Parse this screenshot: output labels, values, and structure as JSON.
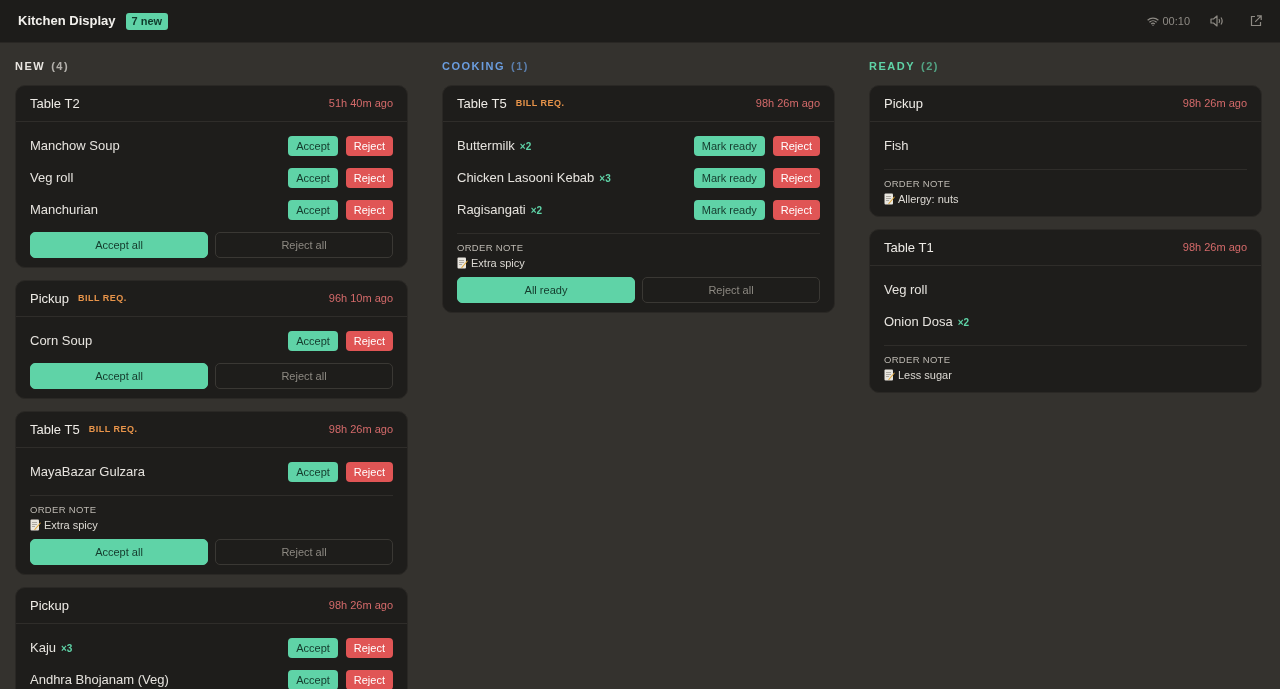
{
  "header": {
    "title": "Kitchen Display",
    "new_badge": "7 new",
    "connection_time": "00:10"
  },
  "columns": [
    {
      "title": "NEW",
      "count": "(4)",
      "color": "#e8e5e0",
      "orders": [
        {
          "name": "Table T2",
          "elapsed": "51h 40m ago",
          "items": [
            {
              "name": "Manchow Soup",
              "actions": [
                {
                  "label": "Accept",
                  "kind": "go"
                },
                {
                  "label": "Reject",
                  "kind": "stop"
                }
              ]
            },
            {
              "name": "Veg roll",
              "actions": [
                {
                  "label": "Accept",
                  "kind": "go"
                },
                {
                  "label": "Reject",
                  "kind": "stop"
                }
              ]
            },
            {
              "name": "Manchurian",
              "actions": [
                {
                  "label": "Accept",
                  "kind": "go"
                },
                {
                  "label": "Reject",
                  "kind": "stop"
                }
              ]
            }
          ],
          "footer": [
            {
              "label": "Accept all",
              "kind": "primary"
            },
            {
              "label": "Reject all",
              "kind": "outline"
            }
          ]
        },
        {
          "name": "Pickup",
          "badge": "BILL REQ.",
          "elapsed": "96h 10m ago",
          "items": [
            {
              "name": "Corn Soup",
              "actions": [
                {
                  "label": "Accept",
                  "kind": "go"
                },
                {
                  "label": "Reject",
                  "kind": "stop"
                }
              ]
            }
          ],
          "footer": [
            {
              "label": "Accept all",
              "kind": "primary"
            },
            {
              "label": "Reject all",
              "kind": "outline"
            }
          ]
        },
        {
          "name": "Table T5",
          "badge": "BILL REQ.",
          "elapsed": "98h 26m ago",
          "items": [
            {
              "name": "MayaBazar Gulzara",
              "actions": [
                {
                  "label": "Accept",
                  "kind": "go"
                },
                {
                  "label": "Reject",
                  "kind": "stop"
                }
              ]
            }
          ],
          "note_label": "ORDER NOTE",
          "note": "Extra spicy",
          "footer": [
            {
              "label": "Accept all",
              "kind": "primary"
            },
            {
              "label": "Reject all",
              "kind": "outline"
            }
          ]
        },
        {
          "name": "Pickup",
          "elapsed": "98h 26m ago",
          "items": [
            {
              "name": "Kaju",
              "qty": "×3",
              "actions": [
                {
                  "label": "Accept",
                  "kind": "go"
                },
                {
                  "label": "Reject",
                  "kind": "stop"
                }
              ]
            },
            {
              "name": "Andhra Bhojanam (Veg)",
              "actions": [
                {
                  "label": "Accept",
                  "kind": "go"
                },
                {
                  "label": "Reject",
                  "kind": "stop"
                }
              ]
            }
          ]
        }
      ]
    },
    {
      "title": "COOKING",
      "count": "(1)",
      "color": "#6b9ee0",
      "orders": [
        {
          "name": "Table T5",
          "badge": "BILL REQ.",
          "elapsed": "98h 26m ago",
          "items": [
            {
              "name": "Buttermilk",
              "qty": "×2",
              "actions": [
                {
                  "label": "Mark ready",
                  "kind": "go"
                },
                {
                  "label": "Reject",
                  "kind": "stop"
                }
              ]
            },
            {
              "name": "Chicken Lasooni Kebab",
              "qty": "×3",
              "actions": [
                {
                  "label": "Mark ready",
                  "kind": "go"
                },
                {
                  "label": "Reject",
                  "kind": "stop"
                }
              ]
            },
            {
              "name": "Ragisangati",
              "qty": "×2",
              "actions": [
                {
                  "label": "Mark ready",
                  "kind": "go"
                },
                {
                  "label": "Reject",
                  "kind": "stop"
                }
              ]
            }
          ],
          "note_label": "ORDER NOTE",
          "note": "Extra spicy",
          "footer": [
            {
              "label": "All ready",
              "kind": "primary"
            },
            {
              "label": "Reject all",
              "kind": "outline"
            }
          ]
        }
      ]
    },
    {
      "title": "READY",
      "count": "(2)",
      "color": "#5fd3a7",
      "orders": [
        {
          "name": "Pickup",
          "elapsed": "98h 26m ago",
          "items": [
            {
              "name": "Fish"
            }
          ],
          "note_label": "ORDER NOTE",
          "note": "Allergy: nuts"
        },
        {
          "name": "Table T1",
          "elapsed": "98h 26m ago",
          "items": [
            {
              "name": "Veg roll"
            },
            {
              "name": "Onion Dosa",
              "qty": "×2"
            }
          ],
          "note_label": "ORDER NOTE",
          "note": "Less sugar"
        }
      ]
    }
  ]
}
